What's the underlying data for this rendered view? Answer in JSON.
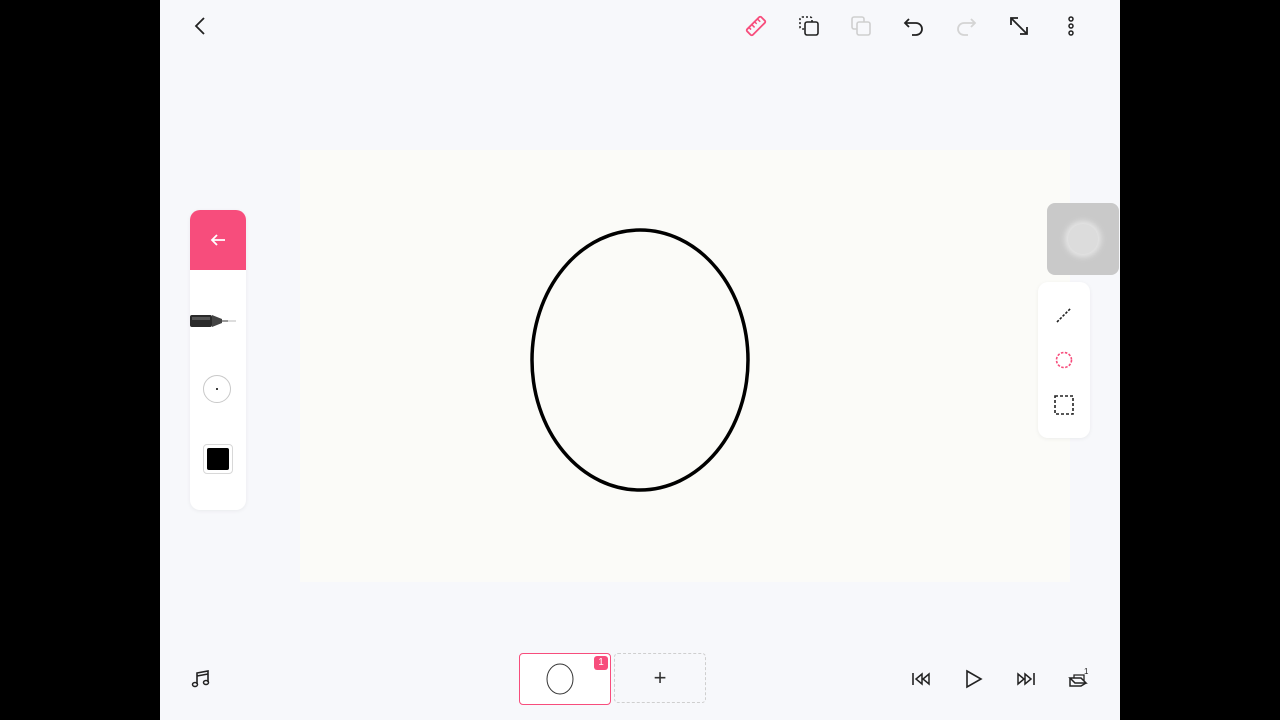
{
  "toolbar": {
    "icons": [
      "chevron-left-icon",
      "ruler-icon",
      "copy-icon",
      "paste-icon",
      "undo-icon",
      "redo-icon",
      "fullscreen-icon",
      "more-vertical-icon"
    ],
    "accent_color": "#f74d7c"
  },
  "tool_panel": {
    "back_icon": "arrow-left-icon",
    "tool": "pen-icon",
    "brush_size": "size-circle-icon",
    "color": "#000000"
  },
  "shape_panel": {
    "items": [
      "line-icon",
      "ellipse-icon",
      "rectangle-icon"
    ],
    "selected": "ellipse-icon"
  },
  "timeline": {
    "frame_badge": "1",
    "add_label": "+",
    "layer_count": "1"
  }
}
